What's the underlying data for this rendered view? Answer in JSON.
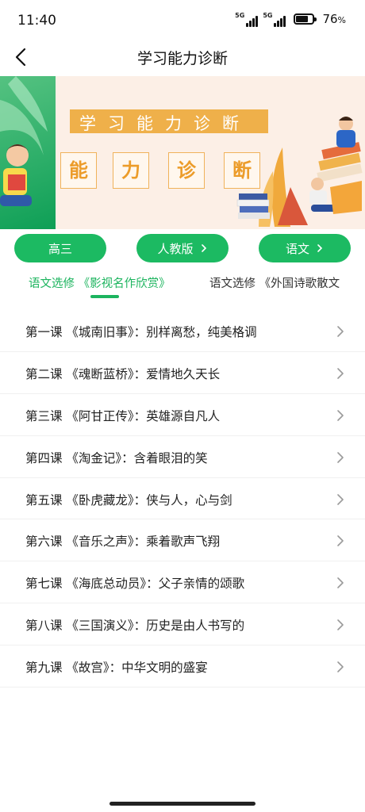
{
  "status_bar": {
    "time": "11:40",
    "network_1": "5G",
    "network_2": "5G",
    "battery_percent": "76",
    "battery_suffix": "%",
    "battery_level": 0.76
  },
  "header": {
    "title": "学习能力诊断"
  },
  "banner": {
    "title": "学习能力诊断",
    "chars": [
      "能",
      "力",
      "诊",
      "断"
    ]
  },
  "filters": [
    {
      "label": "高三",
      "has_arrow": false
    },
    {
      "label": "人教版",
      "has_arrow": true
    },
    {
      "label": "语文",
      "has_arrow": true
    }
  ],
  "tabs": [
    {
      "label": "语文选修 《影视名作欣赏》",
      "active": true
    },
    {
      "label": "语文选修 《外国诗歌散文",
      "active": false
    }
  ],
  "lessons": [
    "第一课 《城南旧事》：别样离愁，纯美格调",
    "第二课 《魂断蓝桥》：爱情地久天长",
    "第三课 《阿甘正传》：英雄源自凡人",
    "第四课 《淘金记》：含着眼泪的笑",
    "第五课 《卧虎藏龙》：侠与人，心与剑",
    "第六课 《音乐之声》：乘着歌声飞翔",
    "第七课 《海底总动员》：父子亲情的颂歌",
    "第八课 《三国演义》：历史是由人书写的",
    "第九课 《故宫》：中华文明的盛宴"
  ],
  "colors": {
    "accent_green": "#1cba62",
    "banner_orange": "#efb04a"
  }
}
